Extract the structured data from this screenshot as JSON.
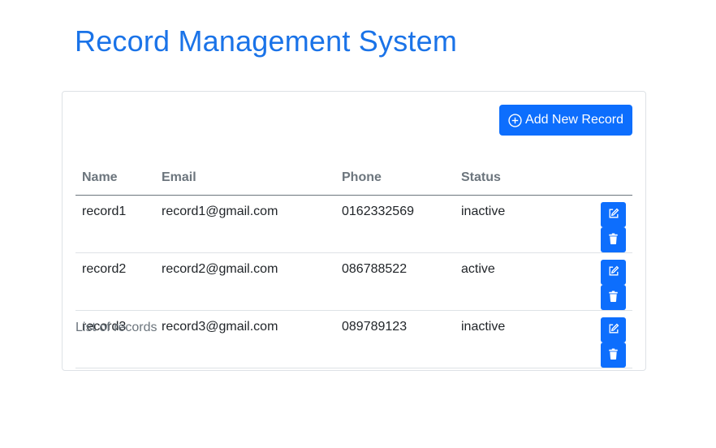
{
  "header": {
    "title": "Record Management System"
  },
  "toolbar": {
    "add_label": "Add New Record",
    "add_icon": "plus-circle-icon"
  },
  "table": {
    "columns": [
      "Name",
      "Email",
      "Phone",
      "Status",
      ""
    ],
    "rows": [
      {
        "name": "record1",
        "email": "record1@gmail.com",
        "phone": "0162332569",
        "status": "inactive"
      },
      {
        "name": "record2",
        "email": "record2@gmail.com",
        "phone": "086788522",
        "status": "active"
      },
      {
        "name": "record3",
        "email": "record3@gmail.com",
        "phone": "089789123",
        "status": "inactive"
      }
    ],
    "caption": "List of records",
    "row_actions": [
      "edit-icon",
      "trash-icon"
    ]
  },
  "colors": {
    "title": "#1a73e8",
    "primary": "#0d6efd",
    "muted": "#6c757d"
  }
}
